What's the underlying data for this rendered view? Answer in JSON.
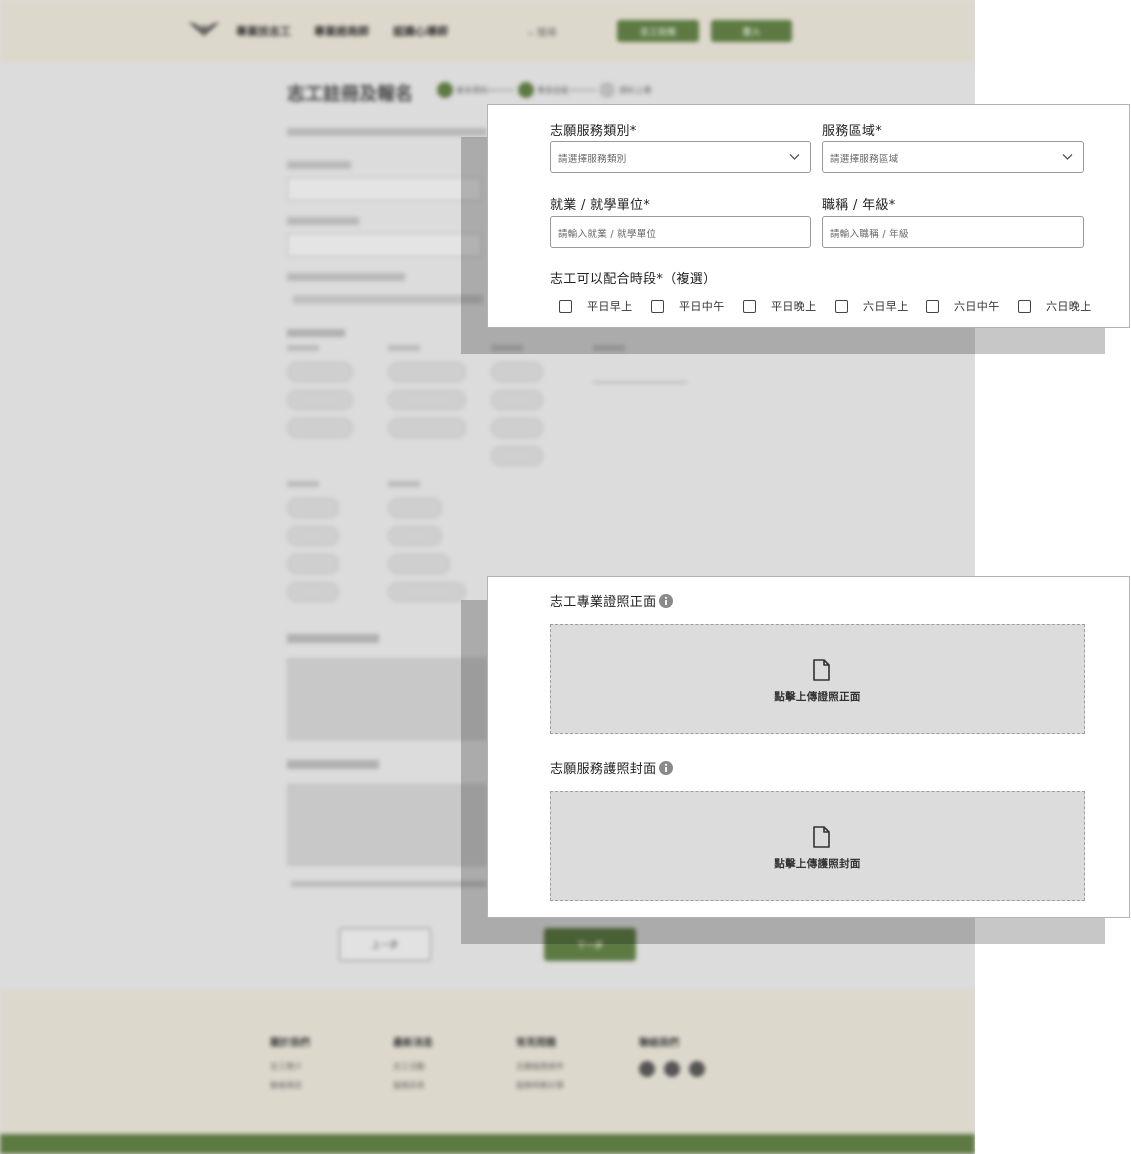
{
  "background_page": {
    "header": {
      "nav_items": [
        "專業技志工",
        "專業諮商師",
        "認識心導師"
      ],
      "search_placeholder": "搜尋",
      "register_button": "志工註冊",
      "login_button": "登入"
    },
    "page_title": "志工註冊及報名",
    "steps": [
      "基本資料",
      "專長技能",
      "資料上傳"
    ],
    "prev_button": "上一步",
    "next_button": "下一步",
    "footer_columns": [
      {
        "title": "關於我們",
        "links": [
          "志工簡介",
          "聯絡資訊"
        ]
      },
      {
        "title": "最新消息",
        "links": [
          "志工活動",
          "服務訊息"
        ]
      },
      {
        "title": "常見問題",
        "links": [
          "志願服務條件",
          "服務時數計算"
        ]
      },
      {
        "title": "聯絡我們",
        "links": []
      }
    ]
  },
  "form_panel": {
    "service_type": {
      "label": "志願服務類別*",
      "placeholder": "請選擇服務類別"
    },
    "service_area": {
      "label": "服務區域*",
      "placeholder": "請選擇服務區域"
    },
    "employer": {
      "label": "就業 / 就學單位*",
      "placeholder": "請輸入就業 / 就學單位"
    },
    "job_title": {
      "label": "職稱 / 年級*",
      "placeholder": "請輸入職稱 / 年級"
    },
    "availability": {
      "label": "志工可以配合時段*（複選）",
      "options": [
        "平日早上",
        "平日中午",
        "平日晚上",
        "六日早上",
        "六日中午",
        "六日晚上"
      ]
    }
  },
  "upload_panel": {
    "license_front": {
      "label": "志工專業證照正面",
      "dropzone_text": "點擊上傳證照正面"
    },
    "passport_cover": {
      "label": "志願服務護照封面",
      "dropzone_text": "點擊上傳護照封面"
    }
  },
  "colors": {
    "brand_green": "#5e7a43",
    "header_beige": "#ddd8cc"
  }
}
